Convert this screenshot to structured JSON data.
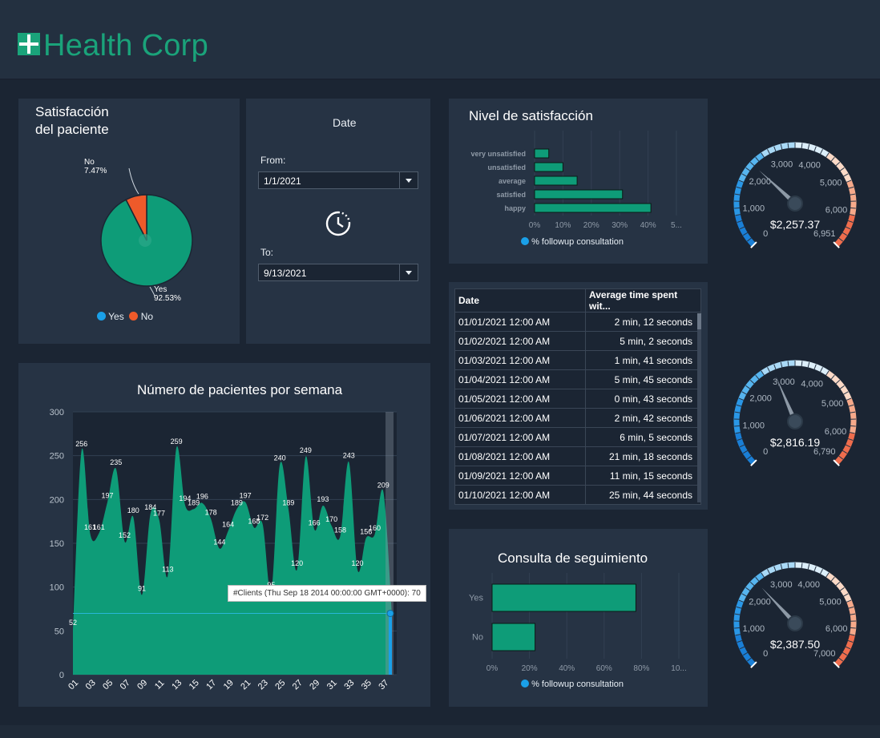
{
  "app": {
    "title": "Health Corp"
  },
  "satisfaction_panel": {
    "title_line1": "Satisfacción",
    "title_line2": "del paciente",
    "legend": [
      "Yes",
      "No"
    ]
  },
  "date_panel": {
    "title": "Date",
    "from_label": "From:",
    "from_value": "1/1/2021",
    "to_label": "To:",
    "to_value": "9/13/2021"
  },
  "nivel_panel": {
    "title": "Nivel de satisfacción",
    "legend": "% followup consultation"
  },
  "table": {
    "headers": [
      "Date",
      "Average time spent wit..."
    ],
    "rows": [
      [
        "01/01/2021 12:00 AM",
        "2 min, 12 seconds"
      ],
      [
        "01/02/2021 12:00 AM",
        "5 min, 2 seconds"
      ],
      [
        "01/03/2021 12:00 AM",
        "1 min, 41 seconds"
      ],
      [
        "01/04/2021 12:00 AM",
        "5 min, 45 seconds"
      ],
      [
        "01/05/2021 12:00 AM",
        "0 min, 43 seconds"
      ],
      [
        "01/06/2021 12:00 AM",
        "2 min, 42 seconds"
      ],
      [
        "01/07/2021 12:00 AM",
        "6 min, 5 seconds"
      ],
      [
        "01/08/2021 12:00 AM",
        "21 min, 18 seconds"
      ],
      [
        "01/09/2021 12:00 AM",
        "11 min, 15 seconds"
      ],
      [
        "01/10/2021 12:00 AM",
        "25 min, 44 seconds"
      ]
    ]
  },
  "weekly_panel": {
    "title": "Número de pacientes  por semana",
    "tooltip": "#Clients (Thu Sep 18 2014 00:00:00 GMT+0000): 70"
  },
  "followup_panel": {
    "title": "Consulta de seguimiento",
    "legend": "% followup consultation"
  },
  "gauges": [
    {
      "value_label": "$2,257.37",
      "value": 2257.37,
      "min": 0,
      "max": 6951,
      "ticks": [
        "0",
        "1,000",
        "2,000",
        "3,000",
        "4,000",
        "5,000",
        "6,000",
        "6,951"
      ]
    },
    {
      "value_label": "$2,816.19",
      "value": 2816.19,
      "min": 0,
      "max": 6790,
      "ticks": [
        "0",
        "1,000",
        "2,000",
        "3,000",
        "4,000",
        "5,000",
        "6,000",
        "6,790"
      ]
    },
    {
      "value_label": "$2,387.50",
      "value": 2387.5,
      "min": 0,
      "max": 7000,
      "ticks": [
        "0",
        "1,000",
        "2,000",
        "3,000",
        "4,000",
        "5,000",
        "6,000",
        "7,000"
      ]
    }
  ],
  "colors": {
    "green": "#0e9c78",
    "orange": "#ee5a2a",
    "blue": "#1aa0e8",
    "background": "#1b2533",
    "panel": "#263344"
  },
  "chart_data": [
    {
      "type": "pie",
      "labels": [
        "Yes",
        "No"
      ],
      "values": [
        92.53,
        7.47
      ],
      "slice_labels": [
        [
          "Yes",
          "92.53%"
        ],
        [
          "No",
          "7.47%"
        ]
      ],
      "colors": [
        "#0e9c78",
        "#ee5a2a"
      ],
      "legend": "bottom"
    },
    {
      "type": "bar",
      "orientation": "horizontal",
      "categories": [
        "very unsatisfied",
        "unsatisfied",
        "average",
        "satisfied",
        "happy"
      ],
      "values": [
        5,
        10,
        15,
        31,
        41
      ],
      "xlim": [
        0,
        50
      ],
      "xticks": [
        "0%",
        "10%",
        "20%",
        "30%",
        "40%",
        "5..."
      ],
      "series": [
        {
          "name": "% followup consultation",
          "values": [
            5,
            10,
            15,
            31,
            41
          ]
        }
      ]
    },
    {
      "type": "area",
      "x": [
        "01",
        "02",
        "03",
        "04",
        "05",
        "06",
        "07",
        "08",
        "09",
        "10",
        "11",
        "12",
        "13",
        "14",
        "15",
        "16",
        "17",
        "18",
        "19",
        "20",
        "21",
        "22",
        "23",
        "24",
        "25",
        "26",
        "27",
        "28",
        "29",
        "30",
        "31",
        "32",
        "33",
        "34",
        "35",
        "36",
        "37",
        "38"
      ],
      "xticks": [
        "01",
        "03",
        "05",
        "07",
        "09",
        "11",
        "13",
        "15",
        "17",
        "19",
        "21",
        "23",
        "25",
        "27",
        "29",
        "31",
        "33",
        "35",
        "37"
      ],
      "values": [
        52,
        256,
        161,
        161,
        197,
        235,
        152,
        180,
        91,
        184,
        177,
        113,
        259,
        194,
        189,
        196,
        178,
        144,
        164,
        189,
        197,
        168,
        172,
        95,
        240,
        189,
        120,
        249,
        166,
        193,
        170,
        158,
        243,
        120,
        156,
        160,
        209,
        70
      ],
      "ylim": [
        0,
        300
      ],
      "yticks": [
        0,
        50,
        100,
        150,
        200,
        250,
        300
      ],
      "grid": true
    },
    {
      "type": "bar",
      "orientation": "horizontal",
      "categories": [
        "Yes",
        "No"
      ],
      "values": [
        77,
        23
      ],
      "xlim": [
        0,
        100
      ],
      "xticks": [
        "0%",
        "20%",
        "40%",
        "60%",
        "80%",
        "10..."
      ],
      "series": [
        {
          "name": "% followup consultation",
          "values": [
            77,
            23
          ]
        }
      ]
    }
  ]
}
